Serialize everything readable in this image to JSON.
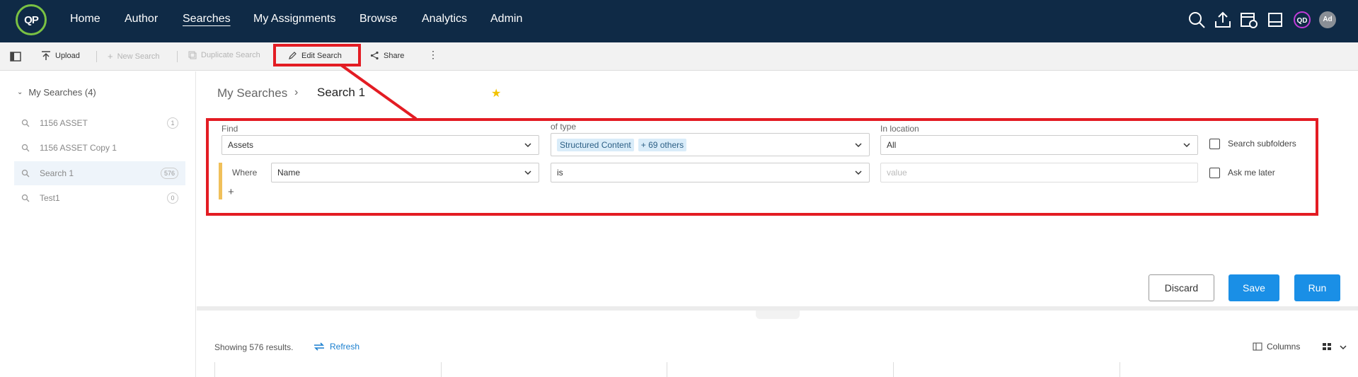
{
  "app": {
    "logo_text": "QP",
    "brand_color": "#7ac143",
    "nav_bg": "#0f2a46"
  },
  "nav": {
    "items": [
      {
        "label": "Home"
      },
      {
        "label": "Author"
      },
      {
        "label": "Searches",
        "active": true
      },
      {
        "label": "My Assignments"
      },
      {
        "label": "Browse"
      },
      {
        "label": "Analytics"
      },
      {
        "label": "Admin"
      }
    ],
    "icons": [
      "search-icon",
      "upload-icon",
      "calendar-clock-icon",
      "inbox-icon"
    ],
    "avatar_qd": "QD",
    "avatar_ad": "Ad"
  },
  "toolbar": {
    "upload": "Upload",
    "new_search": "New Search",
    "duplicate_search": "Duplicate Search",
    "edit_search": "Edit Search",
    "share": "Share"
  },
  "sidebar": {
    "header": "My Searches (4)",
    "items": [
      {
        "label": "1156 ASSET",
        "count": "1"
      },
      {
        "label": "1156 ASSET Copy 1",
        "count": ""
      },
      {
        "label": "Search 1",
        "count": "576",
        "selected": true
      },
      {
        "label": "Test1",
        "count": "0"
      }
    ]
  },
  "breadcrumb": {
    "root": "My Searches",
    "separator": "›",
    "title": "Search 1"
  },
  "query": {
    "find_label": "Find",
    "find_value": "Assets",
    "type_label": "of type",
    "type_chip": "Structured Content",
    "type_more": "+ 69 others",
    "location_label": "In location",
    "location_value": "All",
    "subfolders_label": "Search subfolders",
    "where_label": "Where",
    "where_field": "Name",
    "where_operator": "is",
    "value_placeholder": "value",
    "ask_later_label": "Ask me later",
    "add_symbol": "+"
  },
  "actions": {
    "discard": "Discard",
    "save": "Save",
    "run": "Run"
  },
  "results": {
    "text": "Showing 576 results.",
    "refresh": "Refresh",
    "columns": "Columns"
  },
  "colors": {
    "highlight": "#e31c23",
    "primary": "#1a8fe6",
    "accent_bar": "#f0c05a"
  }
}
